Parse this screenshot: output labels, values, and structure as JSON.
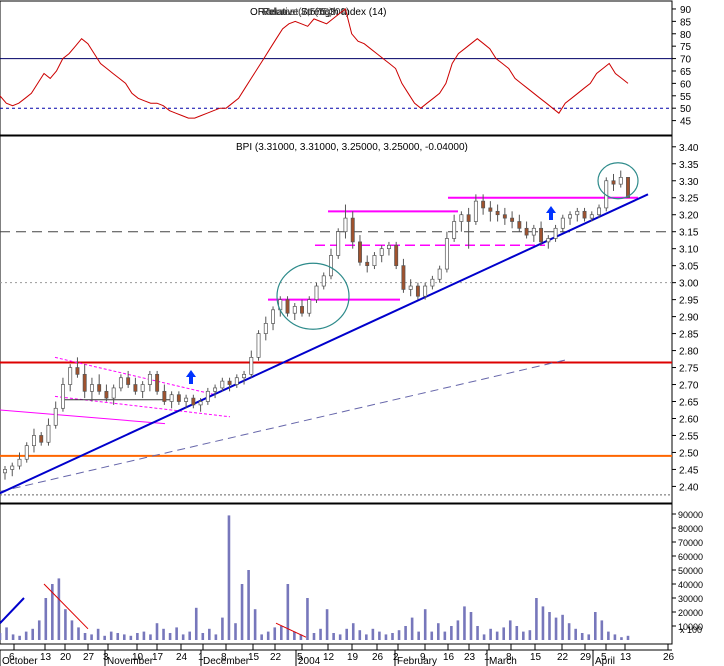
{
  "colors": {
    "rsi_line": "#cc0000",
    "up_candle": "#ffffff",
    "down_candle": "#a0522d",
    "candle_outline": "#555555",
    "trendline": "#0000cc",
    "channel": "#ff00ff",
    "red_level": "#dd0000",
    "orange_level": "#ff6600",
    "volume_bar": "#7777bb",
    "circle": "#2e8b8b",
    "arrow": "#0033ff",
    "grid_dash": "#444444"
  },
  "chart_data": [
    {
      "type": "line",
      "title": "Relative Strength Index (14)",
      "overlay_text": [
        "OR",
        "Relative Strength Index (14)",
        "Volume (7,575,300)",
        "Momentum (18)"
      ],
      "ylim": [
        40,
        92
      ],
      "yticks": [
        45,
        50,
        55,
        60,
        65,
        70,
        75,
        80,
        85,
        90
      ],
      "reference_lines": [
        70,
        50
      ],
      "series": [
        {
          "name": "RSI",
          "values": [
            55,
            52,
            51,
            52,
            54,
            56,
            60,
            64,
            62,
            65,
            70,
            72,
            75,
            78,
            76,
            72,
            68,
            66,
            64,
            62,
            60,
            56,
            54,
            53,
            52,
            52,
            51,
            49,
            48,
            47,
            46,
            46,
            47,
            48,
            49,
            50,
            50,
            52,
            54,
            58,
            62,
            66,
            70,
            74,
            78,
            82,
            84,
            85,
            84,
            83,
            86,
            85,
            84,
            86,
            88,
            90,
            80,
            77,
            76,
            74,
            72,
            70,
            68,
            66,
            60,
            56,
            52,
            50,
            52,
            54,
            56,
            60,
            68,
            72,
            74,
            76,
            78,
            76,
            74,
            70,
            68,
            66,
            62,
            60,
            58,
            56,
            54,
            52,
            50,
            48,
            52,
            54,
            56,
            58,
            60,
            64,
            66,
            68,
            64,
            62,
            60
          ]
        }
      ]
    },
    {
      "type": "candlestick",
      "title": "BPI (3.31000, 3.31000, 3.25000, 3.25000, -0.04000)",
      "ylim": [
        2.36,
        3.42
      ],
      "yticks": [
        2.4,
        2.45,
        2.5,
        2.55,
        2.6,
        2.65,
        2.7,
        2.75,
        2.8,
        2.85,
        2.9,
        2.95,
        3.0,
        3.05,
        3.1,
        3.15,
        3.2,
        3.25,
        3.3,
        3.35,
        3.4
      ],
      "yticklabels": [
        "2.40",
        "2.45",
        "2.50",
        "2.55",
        "2.60",
        "2.65",
        "2.70",
        "2.75",
        "2.80",
        "2.85",
        "2.90",
        "2.95",
        "3.00",
        "3.05",
        "3.10",
        "3.15",
        "3.20",
        "3.25",
        "3.30",
        "3.35",
        "3.40"
      ],
      "series": [
        {
          "name": "BPI",
          "ohlc": [
            [
              2.44,
              2.46,
              2.42,
              2.45
            ],
            [
              2.45,
              2.47,
              2.43,
              2.46
            ],
            [
              2.46,
              2.5,
              2.45,
              2.48
            ],
            [
              2.48,
              2.53,
              2.47,
              2.52
            ],
            [
              2.52,
              2.57,
              2.5,
              2.55
            ],
            [
              2.55,
              2.56,
              2.52,
              2.53
            ],
            [
              2.53,
              2.6,
              2.52,
              2.58
            ],
            [
              2.58,
              2.65,
              2.57,
              2.63
            ],
            [
              2.63,
              2.72,
              2.62,
              2.7
            ],
            [
              2.7,
              2.76,
              2.68,
              2.75
            ],
            [
              2.75,
              2.78,
              2.72,
              2.73
            ],
            [
              2.73,
              2.76,
              2.66,
              2.68
            ],
            [
              2.68,
              2.72,
              2.65,
              2.7
            ],
            [
              2.7,
              2.73,
              2.67,
              2.68
            ],
            [
              2.68,
              2.7,
              2.65,
              2.66
            ],
            [
              2.66,
              2.7,
              2.64,
              2.69
            ],
            [
              2.69,
              2.73,
              2.68,
              2.72
            ],
            [
              2.72,
              2.74,
              2.69,
              2.7
            ],
            [
              2.7,
              2.72,
              2.67,
              2.68
            ],
            [
              2.68,
              2.71,
              2.66,
              2.7
            ],
            [
              2.7,
              2.74,
              2.68,
              2.73
            ],
            [
              2.73,
              2.74,
              2.67,
              2.68
            ],
            [
              2.68,
              2.7,
              2.64,
              2.65
            ],
            [
              2.65,
              2.68,
              2.63,
              2.67
            ],
            [
              2.67,
              2.68,
              2.64,
              2.65
            ],
            [
              2.65,
              2.67,
              2.63,
              2.66
            ],
            [
              2.66,
              2.67,
              2.63,
              2.64
            ],
            [
              2.64,
              2.66,
              2.62,
              2.65
            ],
            [
              2.65,
              2.69,
              2.64,
              2.68
            ],
            [
              2.68,
              2.7,
              2.66,
              2.69
            ],
            [
              2.69,
              2.72,
              2.68,
              2.71
            ],
            [
              2.71,
              2.72,
              2.68,
              2.7
            ],
            [
              2.7,
              2.73,
              2.69,
              2.72
            ],
            [
              2.72,
              2.74,
              2.7,
              2.73
            ],
            [
              2.73,
              2.8,
              2.72,
              2.78
            ],
            [
              2.78,
              2.86,
              2.77,
              2.85
            ],
            [
              2.85,
              2.9,
              2.83,
              2.88
            ],
            [
              2.88,
              2.93,
              2.86,
              2.92
            ],
            [
              2.92,
              2.96,
              2.9,
              2.95
            ],
            [
              2.95,
              2.96,
              2.9,
              2.91
            ],
            [
              2.91,
              2.94,
              2.89,
              2.93
            ],
            [
              2.93,
              2.95,
              2.9,
              2.91
            ],
            [
              2.91,
              2.96,
              2.9,
              2.95
            ],
            [
              2.95,
              3.0,
              2.94,
              2.99
            ],
            [
              2.99,
              3.03,
              2.98,
              3.02
            ],
            [
              3.02,
              3.1,
              3.01,
              3.08
            ],
            [
              3.08,
              3.16,
              3.07,
              3.15
            ],
            [
              3.15,
              3.23,
              3.13,
              3.19
            ],
            [
              3.19,
              3.21,
              3.1,
              3.12
            ],
            [
              3.12,
              3.14,
              3.05,
              3.06
            ],
            [
              3.06,
              3.08,
              3.03,
              3.05
            ],
            [
              3.05,
              3.09,
              3.04,
              3.08
            ],
            [
              3.08,
              3.11,
              3.06,
              3.1
            ],
            [
              3.1,
              3.12,
              3.08,
              3.11
            ],
            [
              3.11,
              3.12,
              3.04,
              3.05
            ],
            [
              3.05,
              3.07,
              2.97,
              2.98
            ],
            [
              2.98,
              3.01,
              2.96,
              2.99
            ],
            [
              2.99,
              3.0,
              2.95,
              2.96
            ],
            [
              2.96,
              3.0,
              2.95,
              2.99
            ],
            [
              2.99,
              3.02,
              2.98,
              3.01
            ],
            [
              3.01,
              3.05,
              3.0,
              3.04
            ],
            [
              3.04,
              3.15,
              3.03,
              3.13
            ],
            [
              3.13,
              3.2,
              3.12,
              3.18
            ],
            [
              3.18,
              3.21,
              3.15,
              3.2
            ],
            [
              3.2,
              3.22,
              3.1,
              3.18
            ],
            [
              3.18,
              3.26,
              3.17,
              3.24
            ],
            [
              3.24,
              3.26,
              3.2,
              3.22
            ],
            [
              3.22,
              3.24,
              3.18,
              3.21
            ],
            [
              3.21,
              3.23,
              3.18,
              3.2
            ],
            [
              3.2,
              3.22,
              3.17,
              3.19
            ],
            [
              3.19,
              3.21,
              3.16,
              3.18
            ],
            [
              3.18,
              3.2,
              3.15,
              3.16
            ],
            [
              3.16,
              3.18,
              3.13,
              3.14
            ],
            [
              3.14,
              3.17,
              3.12,
              3.16
            ],
            [
              3.16,
              3.18,
              3.11,
              3.12
            ],
            [
              3.12,
              3.14,
              3.1,
              3.13
            ],
            [
              3.13,
              3.17,
              3.12,
              3.16
            ],
            [
              3.16,
              3.2,
              3.15,
              3.19
            ],
            [
              3.19,
              3.21,
              3.17,
              3.2
            ],
            [
              3.2,
              3.22,
              3.18,
              3.21
            ],
            [
              3.21,
              3.22,
              3.18,
              3.19
            ],
            [
              3.19,
              3.21,
              3.18,
              3.2
            ],
            [
              3.2,
              3.23,
              3.19,
              3.22
            ],
            [
              3.22,
              3.31,
              3.21,
              3.3
            ],
            [
              3.3,
              3.32,
              3.27,
              3.29
            ],
            [
              3.29,
              3.33,
              3.28,
              3.31
            ],
            [
              3.31,
              3.31,
              3.25,
              3.25
            ]
          ]
        }
      ],
      "annotations": {
        "horizontal_lines": [
          {
            "value": 2.765,
            "color": "red"
          },
          {
            "value": 2.49,
            "color": "orange"
          },
          {
            "value": 3.15,
            "style": "dashed"
          }
        ],
        "channel_lines": [
          3.21,
          2.95,
          3.25,
          3.11
        ],
        "markers": [
          "up-arrow",
          "up-arrow"
        ],
        "circles": 2
      }
    },
    {
      "type": "bar",
      "title": "Volume",
      "ylim": [
        0,
        95000
      ],
      "yticks": [
        10000,
        20000,
        30000,
        40000,
        50000,
        60000,
        70000,
        80000,
        90000
      ],
      "yticklabels": [
        "10000",
        "20000",
        "30000",
        "40000",
        "50000",
        "60000",
        "70000",
        "80000",
        "90000"
      ],
      "scale_note": "x 100",
      "series": [
        {
          "name": "Volume",
          "values": [
            5000,
            9000,
            4000,
            3000,
            6000,
            8000,
            14000,
            30000,
            40000,
            44000,
            22000,
            14000,
            9000,
            5000,
            4000,
            8000,
            3000,
            6000,
            5000,
            4000,
            3000,
            5000,
            6000,
            4000,
            12000,
            8000,
            5000,
            9000,
            4000,
            6000,
            23000,
            5000,
            8000,
            4000,
            16000,
            89000,
            12000,
            40000,
            50000,
            22000,
            4000,
            6000,
            9000,
            10000,
            40000,
            6000,
            4000,
            30000,
            5000,
            8000,
            22000,
            5000,
            4000,
            8000,
            12000,
            7000,
            4000,
            8000,
            6000,
            4000,
            5000,
            7000,
            10000,
            16000,
            6000,
            22000,
            6000,
            12000,
            6000,
            10000,
            14000,
            24000,
            20000,
            10000,
            4000,
            8000,
            6000,
            9000,
            14000,
            10000,
            6000,
            7000,
            30000,
            24000,
            20000,
            16000,
            18000,
            12000,
            8000,
            5000,
            4000,
            20000,
            14000,
            6000,
            4000,
            2000,
            3000
          ]
        }
      ]
    }
  ],
  "x_axis": {
    "tick_labels": [
      "6",
      "13",
      "20",
      "27",
      "3",
      "10",
      "17",
      "24",
      "1",
      "8",
      "15",
      "22",
      "5",
      "12",
      "19",
      "26",
      "2",
      "9",
      "16",
      "23",
      "1",
      "8",
      "15",
      "22",
      "29",
      "5",
      "13",
      "26"
    ],
    "month_labels": [
      "October",
      "November",
      "December",
      "2004",
      "February",
      "March",
      "April"
    ]
  }
}
